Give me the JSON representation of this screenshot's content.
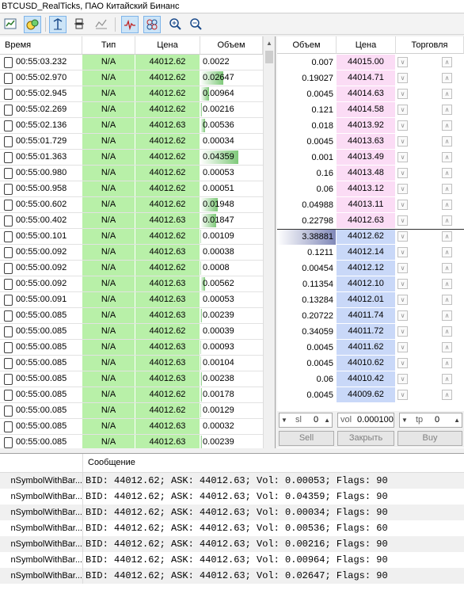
{
  "window": {
    "title": "BTCUSD_RealTicks, ПАО Китайский Бинанс"
  },
  "toolbar": {
    "buttons": [
      "chart-icon",
      "ticks-icon",
      "auto-scroll-icon",
      "depth-icon",
      "filter-icon",
      "tick-chart-icon",
      "all-ticks-icon",
      "zoom-in-icon",
      "zoom-out-icon"
    ]
  },
  "ticks": {
    "headers": {
      "time": "Время",
      "type": "Тип",
      "price": "Цена",
      "volume": "Объем"
    },
    "rows": [
      {
        "time": "00:55:03.232",
        "type": "N/A",
        "price": "44012.62",
        "vol": "0.0022",
        "bar": 0.0
      },
      {
        "time": "00:55:02.970",
        "type": "N/A",
        "price": "44012.62",
        "vol": "0.02647",
        "bar": 0.61
      },
      {
        "time": "00:55:02.945",
        "type": "N/A",
        "price": "44012.62",
        "vol": "0.00964",
        "bar": 0.22
      },
      {
        "time": "00:55:02.269",
        "type": "N/A",
        "price": "44012.62",
        "vol": "0.00216",
        "bar": 0.05
      },
      {
        "time": "00:55:02.136",
        "type": "N/A",
        "price": "44012.63",
        "vol": "0.00536",
        "bar": 0.12
      },
      {
        "time": "00:55:01.729",
        "type": "N/A",
        "price": "44012.62",
        "vol": "0.00034",
        "bar": 0.0
      },
      {
        "time": "00:55:01.363",
        "type": "N/A",
        "price": "44012.62",
        "vol": "0.04359",
        "bar": 1.0
      },
      {
        "time": "00:55:00.980",
        "type": "N/A",
        "price": "44012.62",
        "vol": "0.00053",
        "bar": 0.01
      },
      {
        "time": "00:55:00.958",
        "type": "N/A",
        "price": "44012.62",
        "vol": "0.00051",
        "bar": 0.01
      },
      {
        "time": "00:55:00.602",
        "type": "N/A",
        "price": "44012.62",
        "vol": "0.01948",
        "bar": 0.45
      },
      {
        "time": "00:55:00.402",
        "type": "N/A",
        "price": "44012.63",
        "vol": "0.01847",
        "bar": 0.42
      },
      {
        "time": "00:55:00.101",
        "type": "N/A",
        "price": "44012.62",
        "vol": "0.00109",
        "bar": 0.02
      },
      {
        "time": "00:55:00.092",
        "type": "N/A",
        "price": "44012.63",
        "vol": "0.00038",
        "bar": 0.0
      },
      {
        "time": "00:55:00.092",
        "type": "N/A",
        "price": "44012.62",
        "vol": "0.0008",
        "bar": 0.02
      },
      {
        "time": "00:55:00.092",
        "type": "N/A",
        "price": "44012.63",
        "vol": "0.00562",
        "bar": 0.13
      },
      {
        "time": "00:55:00.091",
        "type": "N/A",
        "price": "44012.63",
        "vol": "0.00053",
        "bar": 0.01
      },
      {
        "time": "00:55:00.085",
        "type": "N/A",
        "price": "44012.63",
        "vol": "0.00239",
        "bar": 0.05
      },
      {
        "time": "00:55:00.085",
        "type": "N/A",
        "price": "44012.62",
        "vol": "0.00039",
        "bar": 0.0
      },
      {
        "time": "00:55:00.085",
        "type": "N/A",
        "price": "44012.63",
        "vol": "0.00093",
        "bar": 0.02
      },
      {
        "time": "00:55:00.085",
        "type": "N/A",
        "price": "44012.63",
        "vol": "0.00104",
        "bar": 0.02
      },
      {
        "time": "00:55:00.085",
        "type": "N/A",
        "price": "44012.63",
        "vol": "0.00238",
        "bar": 0.05
      },
      {
        "time": "00:55:00.085",
        "type": "N/A",
        "price": "44012.62",
        "vol": "0.00178",
        "bar": 0.04
      },
      {
        "time": "00:55:00.085",
        "type": "N/A",
        "price": "44012.62",
        "vol": "0.00129",
        "bar": 0.03
      },
      {
        "time": "00:55:00.085",
        "type": "N/A",
        "price": "44012.63",
        "vol": "0.00032",
        "bar": 0.0
      },
      {
        "time": "00:55:00.085",
        "type": "N/A",
        "price": "44012.63",
        "vol": "0.00239",
        "bar": 0.05
      }
    ]
  },
  "depth": {
    "headers": {
      "volume": "Объем",
      "price": "Цена",
      "trade": "Торговля"
    },
    "asks": [
      {
        "vol": "0.007",
        "price": "44015.00"
      },
      {
        "vol": "0.19027",
        "price": "44014.71"
      },
      {
        "vol": "0.0045",
        "price": "44014.63"
      },
      {
        "vol": "0.121",
        "price": "44014.58"
      },
      {
        "vol": "0.018",
        "price": "44013.92"
      },
      {
        "vol": "0.0045",
        "price": "44013.63"
      },
      {
        "vol": "0.001",
        "price": "44013.49"
      },
      {
        "vol": "0.16",
        "price": "44013.48"
      },
      {
        "vol": "0.06",
        "price": "44013.12"
      },
      {
        "vol": "0.04988",
        "price": "44013.11"
      },
      {
        "vol": "0.22798",
        "price": "44012.63"
      }
    ],
    "bids": [
      {
        "vol": "3.38881",
        "price": "44012.62"
      },
      {
        "vol": "0.1211",
        "price": "44012.14"
      },
      {
        "vol": "0.00454",
        "price": "44012.12"
      },
      {
        "vol": "0.11354",
        "price": "44012.10"
      },
      {
        "vol": "0.13284",
        "price": "44012.01"
      },
      {
        "vol": "0.20722",
        "price": "44011.74"
      },
      {
        "vol": "0.34059",
        "price": "44011.72"
      },
      {
        "vol": "0.0045",
        "price": "44011.62"
      },
      {
        "vol": "0.0045",
        "price": "44010.62"
      },
      {
        "vol": "0.06",
        "price": "44010.42"
      },
      {
        "vol": "0.0045",
        "price": "44009.62"
      }
    ]
  },
  "trade": {
    "sl_label": "sl",
    "sl_value": "0",
    "vol_label": "vol",
    "vol_value": "0.000100",
    "tp_label": "tp",
    "tp_value": "0",
    "sell_label": "Sell",
    "close_label": "Закрыть",
    "buy_label": "Buy"
  },
  "log": {
    "header": "Сообщение",
    "rows": [
      {
        "src": "nSymbolWithBar...",
        "msg": "BID: 44012.62; ASK: 44012.63; Vol: 0.00053; Flags: 90"
      },
      {
        "src": "nSymbolWithBar...",
        "msg": "BID: 44012.62; ASK: 44012.63; Vol: 0.04359; Flags: 90"
      },
      {
        "src": "nSymbolWithBar...",
        "msg": "BID: 44012.62; ASK: 44012.63; Vol: 0.00034; Flags: 90"
      },
      {
        "src": "nSymbolWithBar...",
        "msg": "BID: 44012.62; ASK: 44012.63; Vol: 0.00536; Flags: 60"
      },
      {
        "src": "nSymbolWithBar...",
        "msg": "BID: 44012.62; ASK: 44012.63; Vol: 0.00216; Flags: 90"
      },
      {
        "src": "nSymbolWithBar...",
        "msg": "BID: 44012.62; ASK: 44012.63; Vol: 0.00964; Flags: 90"
      },
      {
        "src": "nSymbolWithBar...",
        "msg": "BID: 44012.62; ASK: 44012.63; Vol: 0.02647; Flags: 90"
      }
    ]
  }
}
